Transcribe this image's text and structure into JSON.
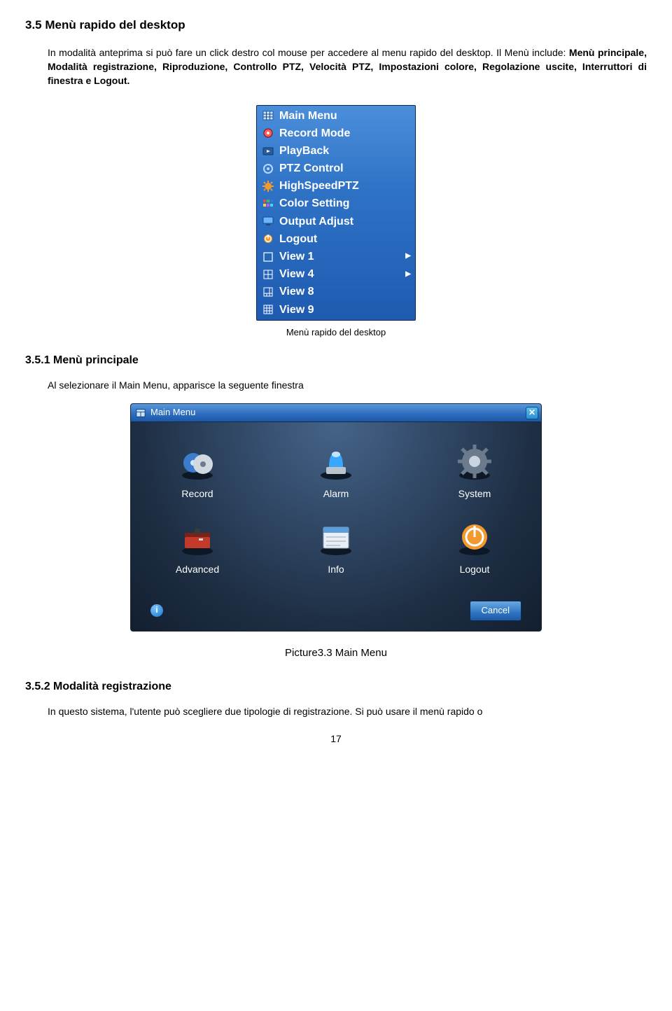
{
  "section35": {
    "title": "3.5 Menù rapido del desktop",
    "para_pre": "In modalità anteprima si può fare un click destro col mouse per accedere al menu rapido del desktop. Il Menù include: ",
    "para_bold": "Menù principale, Modalità registrazione, Riproduzione, Controllo PTZ, Velocità PTZ, Impostazioni colore, Regolazione uscite, Interruttori di finestra e Logout."
  },
  "desktop_menu": {
    "items": [
      {
        "icon": "grid-3-icon",
        "label": "Main Menu",
        "arrow": false
      },
      {
        "icon": "disc-icon",
        "label": "Record Mode",
        "arrow": false
      },
      {
        "icon": "player-icon",
        "label": "PlayBack",
        "arrow": false
      },
      {
        "icon": "joystick-icon",
        "label": "PTZ Control",
        "arrow": false
      },
      {
        "icon": "gear-icon",
        "label": "HighSpeedPTZ",
        "arrow": false
      },
      {
        "icon": "palette-icon",
        "label": "Color Setting",
        "arrow": false
      },
      {
        "icon": "monitor-icon",
        "label": "Output Adjust",
        "arrow": false
      },
      {
        "icon": "power-icon",
        "label": "Logout",
        "arrow": false
      },
      {
        "icon": "view1-icon",
        "label": "View 1",
        "arrow": true
      },
      {
        "icon": "view4-icon",
        "label": "View 4",
        "arrow": true
      },
      {
        "icon": "view8-icon",
        "label": "View 8",
        "arrow": false
      },
      {
        "icon": "view9-icon",
        "label": "View 9",
        "arrow": false
      }
    ],
    "caption": "Menù rapido del desktop"
  },
  "section351": {
    "title": "3.5.1 Menù principale",
    "intro": "Al selezionare il Main Menu, apparisce la seguente finestra"
  },
  "main_menu": {
    "title": "Main Menu",
    "items": [
      {
        "icon": "record-icon",
        "label": "Record"
      },
      {
        "icon": "alarm-icon",
        "label": "Alarm"
      },
      {
        "icon": "system-icon",
        "label": "System"
      },
      {
        "icon": "advanced-icon",
        "label": "Advanced"
      },
      {
        "icon": "info-window-icon",
        "label": "Info"
      },
      {
        "icon": "logout-icon",
        "label": "Logout"
      }
    ],
    "cancel": "Cancel",
    "caption": "Picture3.3 Main Menu"
  },
  "section352": {
    "title": "3.5.2 Modalità registrazione",
    "intro": "In questo sistema, l'utente può scegliere due tipologie di registrazione. Si può usare il menù rapido o"
  },
  "page_number": "17"
}
